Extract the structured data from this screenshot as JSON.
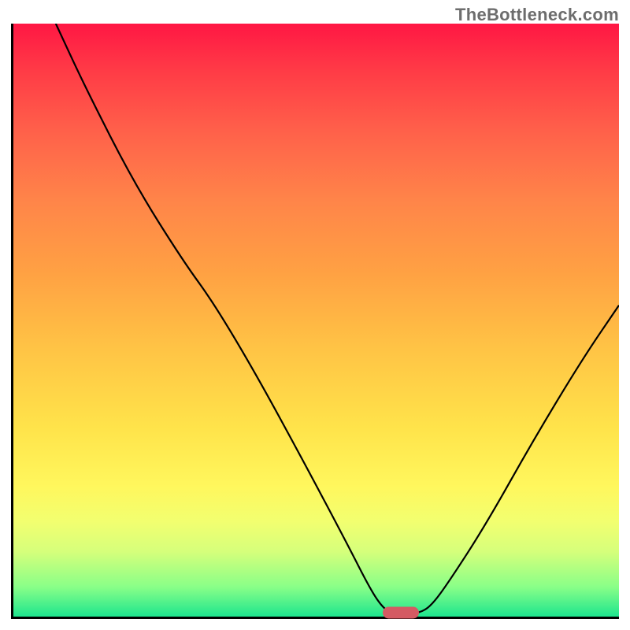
{
  "attribution": "TheBottleneck.com",
  "chart_data": {
    "type": "line",
    "title": "",
    "xlabel": "",
    "ylabel": "",
    "xlim": [
      0,
      100
    ],
    "ylim": [
      0,
      100
    ],
    "grid": false,
    "legend": false,
    "annotations": [],
    "background_gradient": {
      "orientation": "vertical",
      "stops": [
        {
          "pos": 0,
          "color": "#ff1744"
        },
        {
          "pos": 8,
          "color": "#ff3b46"
        },
        {
          "pos": 18,
          "color": "#ff604a"
        },
        {
          "pos": 30,
          "color": "#ff8549"
        },
        {
          "pos": 42,
          "color": "#ffa143"
        },
        {
          "pos": 55,
          "color": "#ffc445"
        },
        {
          "pos": 68,
          "color": "#ffe34a"
        },
        {
          "pos": 78,
          "color": "#fff75d"
        },
        {
          "pos": 84,
          "color": "#f2ff70"
        },
        {
          "pos": 89,
          "color": "#d6ff7b"
        },
        {
          "pos": 95,
          "color": "#89ff88"
        },
        {
          "pos": 100,
          "color": "#1de58e"
        }
      ]
    },
    "series": [
      {
        "name": "curve",
        "color": "#000000",
        "points": [
          {
            "x": 7.0,
            "y": 100.0
          },
          {
            "x": 12.0,
            "y": 89.0
          },
          {
            "x": 20.0,
            "y": 73.0
          },
          {
            "x": 28.0,
            "y": 60.0
          },
          {
            "x": 33.0,
            "y": 53.0
          },
          {
            "x": 40.0,
            "y": 41.0
          },
          {
            "x": 48.0,
            "y": 26.0
          },
          {
            "x": 55.0,
            "y": 12.5
          },
          {
            "x": 59.0,
            "y": 4.5
          },
          {
            "x": 61.0,
            "y": 1.5
          },
          {
            "x": 62.5,
            "y": 0.6
          },
          {
            "x": 65.0,
            "y": 0.6
          },
          {
            "x": 67.0,
            "y": 0.6
          },
          {
            "x": 69.0,
            "y": 1.8
          },
          {
            "x": 72.0,
            "y": 6.0
          },
          {
            "x": 78.0,
            "y": 15.5
          },
          {
            "x": 86.0,
            "y": 30.0
          },
          {
            "x": 94.0,
            "y": 43.5
          },
          {
            "x": 100.0,
            "y": 52.5
          }
        ]
      }
    ],
    "marker": {
      "x": 64.0,
      "y": 0.6,
      "color": "#d45a63",
      "shape": "pill"
    }
  }
}
